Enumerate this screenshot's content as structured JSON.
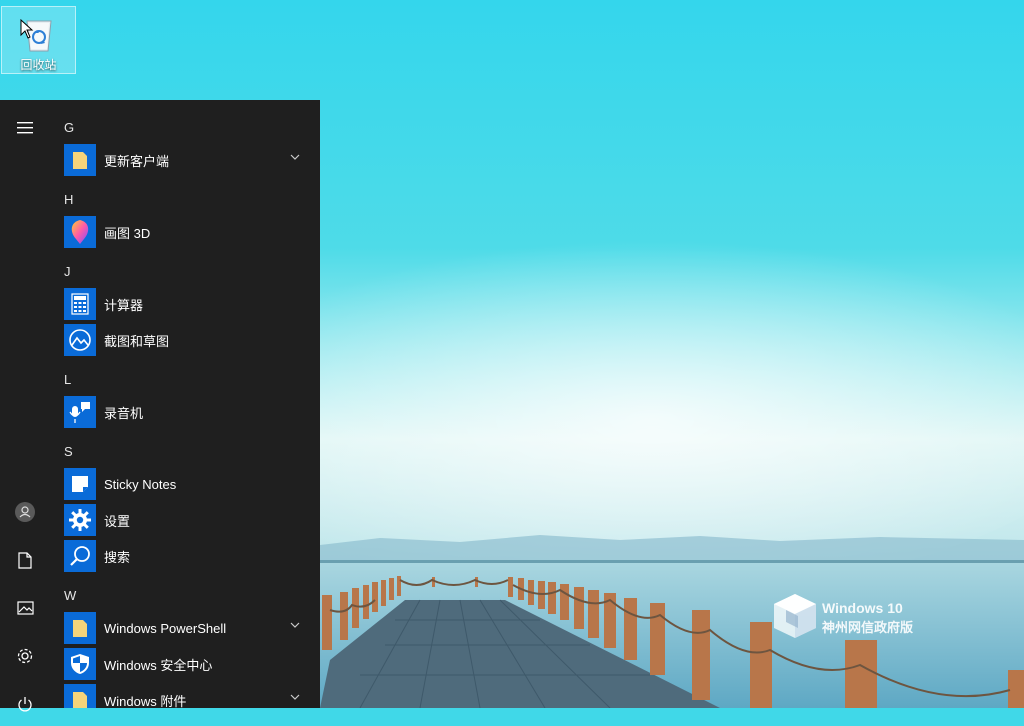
{
  "desktop": {
    "recycle_bin_label": "回收站"
  },
  "start_menu": {
    "groups": [
      {
        "letter": "G"
      },
      {
        "letter": "H"
      },
      {
        "letter": "J"
      },
      {
        "letter": "L"
      },
      {
        "letter": "S"
      },
      {
        "letter": "W"
      }
    ],
    "apps": [
      {
        "name": "更新客户端",
        "icon": "folder-icon",
        "expandable": true
      },
      {
        "name": "画图 3D",
        "icon": "paint3d-icon"
      },
      {
        "name": "计算器",
        "icon": "calculator-icon"
      },
      {
        "name": "截图和草图",
        "icon": "snip-sketch-icon"
      },
      {
        "name": "录音机",
        "icon": "voice-recorder-icon"
      },
      {
        "name": "Sticky Notes",
        "icon": "sticky-notes-icon"
      },
      {
        "name": "设置",
        "icon": "gear-icon"
      },
      {
        "name": "搜索",
        "icon": "search-icon"
      },
      {
        "name": "Windows PowerShell",
        "icon": "folder-icon",
        "expandable": true
      },
      {
        "name": "Windows 安全中心",
        "icon": "shield-icon"
      },
      {
        "name": "Windows 附件",
        "icon": "folder-icon",
        "expandable": true
      }
    ],
    "rail_icons": [
      "hamburger-icon",
      "user-avatar-icon",
      "document-icon",
      "pictures-icon",
      "settings-gear-icon",
      "power-icon"
    ]
  },
  "watermark": {
    "line1": "Windows 10",
    "line2": "神州网信政府版"
  },
  "colors": {
    "menu_bg": "#1f1f1f",
    "tile_blue": "#0a6bd8",
    "folder_yellow": "#f5d47a"
  }
}
